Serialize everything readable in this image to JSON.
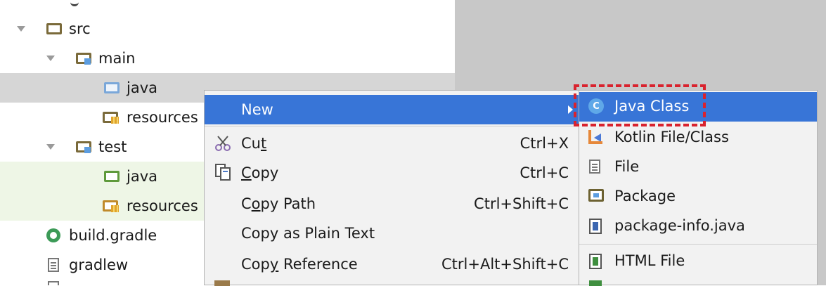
{
  "project_tree": {
    "items": [
      {
        "label": "src"
      },
      {
        "label": "main"
      },
      {
        "label": "java"
      },
      {
        "label": "resources"
      },
      {
        "label": "test"
      },
      {
        "label": "java"
      },
      {
        "label": "resources"
      },
      {
        "label": "build.gradle"
      },
      {
        "label": "gradlew"
      }
    ]
  },
  "context_menu": {
    "new_label": "New",
    "cut": {
      "pre": "Cu",
      "mn": "t",
      "post": "",
      "shortcut": "Ctrl+X"
    },
    "copy": {
      "pre": "",
      "mn": "C",
      "post": "opy",
      "shortcut": "Ctrl+C"
    },
    "copy_path": {
      "pre": "C",
      "mn": "o",
      "post": "py Path",
      "shortcut": "Ctrl+Shift+C"
    },
    "copy_plain": {
      "label": "Copy as Plain Text"
    },
    "copy_ref": {
      "pre": "Cop",
      "mn": "y",
      "post": " Reference",
      "shortcut": "Ctrl+Alt+Shift+C"
    }
  },
  "submenu": {
    "items": [
      {
        "label": "Java Class",
        "icon": "java-class-icon",
        "icon_letter": "C"
      },
      {
        "label": "Kotlin File/Class",
        "icon": "kotlin-icon"
      },
      {
        "label": "File",
        "icon": "file-icon"
      },
      {
        "label": "Package",
        "icon": "package-icon"
      },
      {
        "label": "package-info.java",
        "icon": "package-info-icon"
      },
      {
        "label": "HTML File",
        "icon": "html-file-icon"
      }
    ]
  },
  "colors": {
    "selection": "#3875d7",
    "highlight_box": "#d9232e",
    "editor_bg": "#c8c8c8"
  }
}
